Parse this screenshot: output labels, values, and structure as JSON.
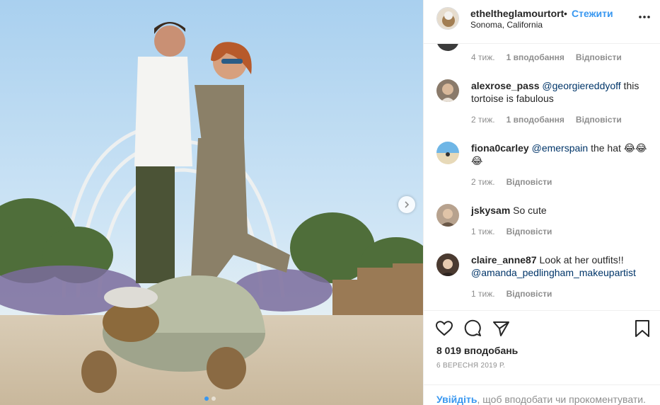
{
  "post": {
    "image_alt_desc": "",
    "nav": {
      "next_icon": "chevron-right-icon"
    },
    "carousel": {
      "count": 2,
      "active": 0
    }
  },
  "header": {
    "username": "etheltheglamourtort",
    "separator": "•",
    "follow_label": "Стежити",
    "location": "Sonoma, California",
    "more_icon": "more-horizontal-icon"
  },
  "comments": [
    {
      "username": "",
      "text": "",
      "time": "4 тиж.",
      "likes": "1 вподобання",
      "reply": "Відповісти"
    },
    {
      "username": "alexrose_pass",
      "mention": "@georgiereddyoff",
      "text_after": " this tortoise is fabulous",
      "time": "2 тиж.",
      "likes": "1 вподобання",
      "reply": "Відповісти"
    },
    {
      "username": "fiona0carley",
      "mention": "@emerspain",
      "text_after": " the hat 😂😂😂",
      "time": "2 тиж.",
      "reply": "Відповісти"
    },
    {
      "username": "jskysam",
      "text_after": "So cute",
      "time": "1 тиж.",
      "reply": "Відповісти"
    },
    {
      "username": "claire_anne87",
      "text_after": "Look at her outfits!!",
      "mention": "@amanda_pedlingham_makeupartist",
      "time": "1 тиж.",
      "reply": "Відповісти"
    }
  ],
  "actions": {
    "like_icon": "heart-icon",
    "comment_icon": "comment-icon",
    "share_icon": "share-icon",
    "save_icon": "bookmark-icon",
    "likes_count": "8 019 вподобань",
    "date": "6 ВЕРЕСНЯ 2019 Р."
  },
  "login_prompt": {
    "link": "Увійдіть",
    "rest": ", щоб вподобати чи прокоментувати."
  },
  "colors": {
    "accent": "#3897f0",
    "text": "#262626",
    "muted": "#8e8e8e",
    "mention": "#003569"
  }
}
